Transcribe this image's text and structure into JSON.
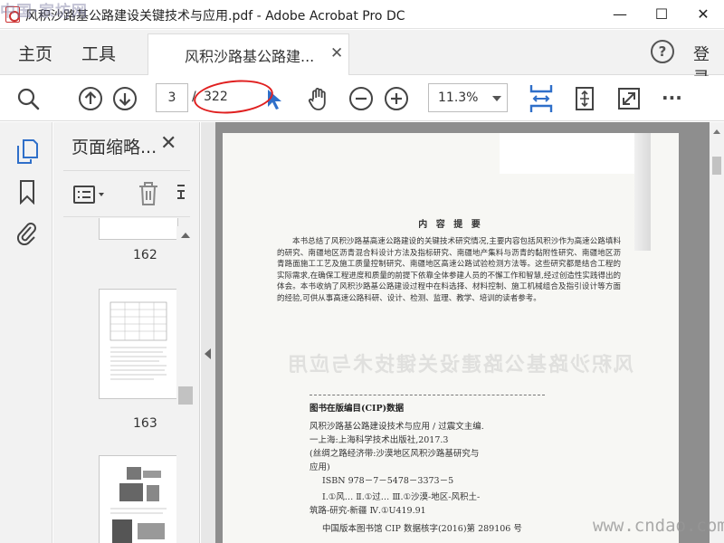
{
  "window": {
    "title": "风积沙路基公路建设关键技术与应用.pdf - Adobe Acrobat Pro DC",
    "watermark_logo": "中国·家坊网",
    "controls": {
      "minimize": "—",
      "maximize": "☐",
      "close": "✕"
    }
  },
  "menu": {
    "home": "主页",
    "tools": "工具",
    "doc_tab": "风积沙路基公路建...",
    "doc_tab_close": "✕",
    "help": "?",
    "login": "登录"
  },
  "toolbar": {
    "current_page": "3",
    "page_separator": "/",
    "total_pages": "322",
    "zoom": "11.3%",
    "more": "···"
  },
  "nav_pane": {
    "title": "页面缩略...",
    "close": "✕",
    "thumbnails": [
      {
        "label": "162"
      },
      {
        "label": "163"
      },
      {
        "label": ""
      }
    ]
  },
  "document": {
    "heading": "内 容 提 要",
    "summary": "本书总结了风积沙路基高速公路建设的关键技术研究情况,主要内容包括风积沙作为高速公路填料的研究、南疆地区沥青混合料设计方法及指标研究、南疆地产集料与沥青的黏附性研究、南疆地区沥青路面施工工艺及施工质量控制研究、南疆地区高速公路试验检测方法等。这些研究都是结合工程的实际需求,在确保工程进度和质量的前提下依靠全体参建人员的不懈工作和智慧,经过创造性实践得出的体会。本书收纳了风积沙路基公路建设过程中在料选择、材料控制、施工机械组合及指引设计等方面的经验,可供从事高速公路科研、设计、检测、监理、教学、培训的读者参考。",
    "ghost_text": "风积沙路基公路建设关键技术与应用",
    "cip_title": "图书在版编目(CIP)数据",
    "cip_lines": [
      "风积沙路基公路建设技术与应用 / 过震文主编.",
      "一上海:上海科学技术出版社,2017.3",
      "(丝绸之路经济带:沙漠地区风积沙路基研究与",
      "应用)",
      "ISBN 978－7－5478－3373－5",
      "Ⅰ.①风…  Ⅱ.①过…  Ⅲ.①沙漠-地区-风积土-",
      "筑路-研究-新疆  Ⅳ.①U419.91",
      "中国版本图书馆 CIP 数据核字(2016)第 289106 号"
    ]
  },
  "watermark_right": "www.cndao.com"
}
